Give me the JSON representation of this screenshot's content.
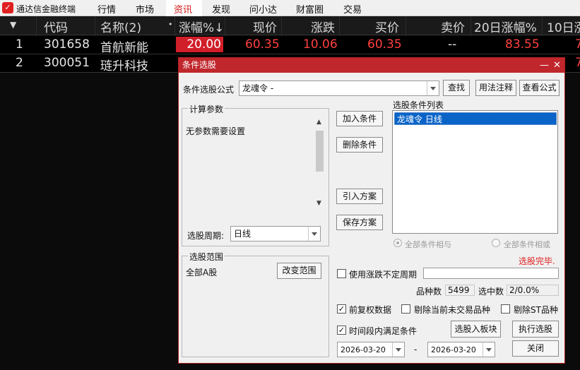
{
  "app": {
    "name": "通达信金融终端",
    "logo_icon": "tdx-logo-icon"
  },
  "menu": [
    "行情",
    "市场",
    "资讯",
    "发现",
    "问小达",
    "财富圈",
    "交易"
  ],
  "menu_active_index": 2,
  "grid": {
    "headers": [
      "▼",
      "代码",
      "名称(2)",
      "•",
      "涨幅%↓",
      "现价",
      "涨跌",
      "买价",
      "卖价",
      "20日涨幅%",
      "10日涨"
    ],
    "rows": [
      {
        "idx": "1",
        "code": "301658",
        "name": "首航新能",
        "pct": "20.00",
        "price": "60.35",
        "change": "10.06",
        "bid": "60.35",
        "ask": "--",
        "pct20": "83.55",
        "pct10": "7"
      },
      {
        "idx": "2",
        "code": "300051",
        "name": "琏升科技",
        "tail": "7"
      }
    ]
  },
  "dialog": {
    "title": "条件选股",
    "min_icon": "minimize-icon",
    "close_icon": "close-icon",
    "formula_label": "条件选股公式",
    "formula_value": "龙魂令  -",
    "find_btn": "查找",
    "usage_btn": "用法注释",
    "view_btn": "查看公式",
    "params_group": "计算参数",
    "params_text": "无参数需要设置",
    "add_btn": "加入条件",
    "del_btn": "删除条件",
    "import_btn": "引入方案",
    "save_btn": "保存方案",
    "cond_list_label": "选股条件列表",
    "cond_items": [
      "龙魂令  日线"
    ],
    "period_label": "选股周期:",
    "period_value": "日线",
    "radio_and": "全部条件相与",
    "radio_or": "全部条件相或",
    "status": "选股完毕.",
    "range_group": "选股范围",
    "range_value": "全部A股",
    "change_range_btn": "改变范围",
    "use_period_label": "使用涨跌不定周期",
    "count_label": "品种数",
    "count_value": "5499",
    "selected_label": "选中数",
    "selected_value": "2/0.0%",
    "prefq_label": "前复权数据",
    "excl_notrade_label": "剔除当前未交易品种",
    "excl_st_label": "剔除ST品种",
    "interval_label": "时间段内满足条件",
    "to_block_btn": "选股入板块",
    "run_btn": "执行选股",
    "date_from": "2026-03-20",
    "date_sep": "-",
    "date_to": "2026-03-20",
    "close_btn": "关闭"
  },
  "colors": {
    "accent": "#c0272d",
    "up": "#ff4040",
    "selection": "#0a64c8"
  }
}
